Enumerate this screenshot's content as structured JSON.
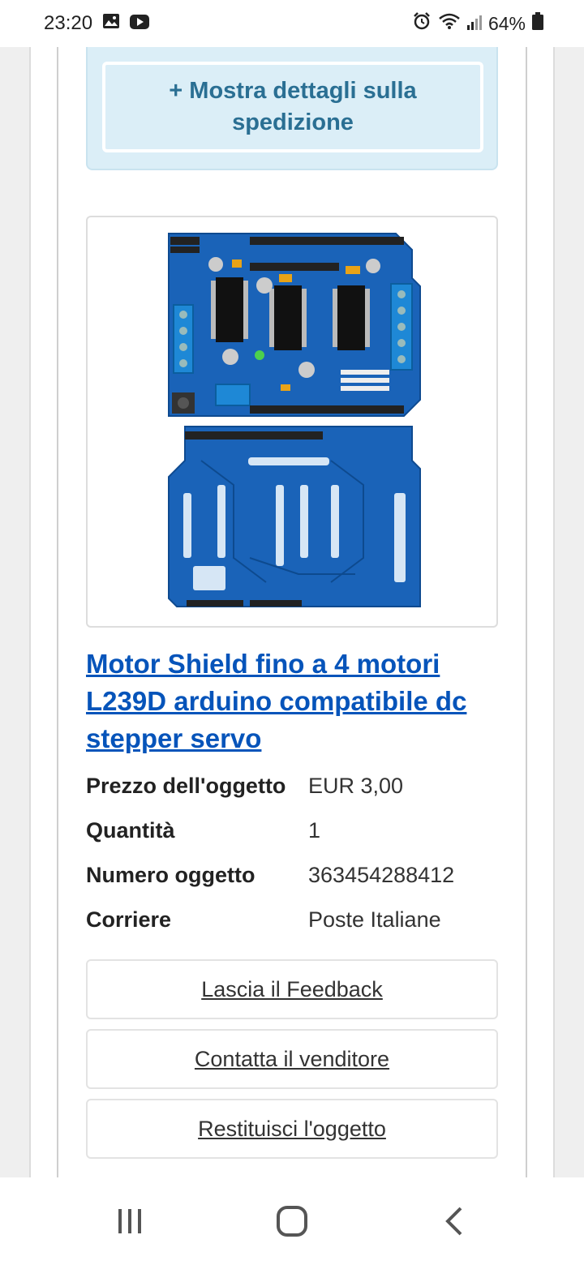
{
  "status_bar": {
    "time": "23:20",
    "battery": "64%",
    "left_icons": [
      "gallery-icon",
      "youtube-icon"
    ],
    "right_icons": [
      "alarm-icon",
      "wifi-icon",
      "signal-icon",
      "battery-icon"
    ]
  },
  "shipping": {
    "toggle_label": "+ Mostra dettagli sulla spedizione"
  },
  "product": {
    "title": "Motor Shield fino a 4 motori L239D arduino compatibile dc stepper servo",
    "image_alt": "Motor Shield L293D PCB top and bottom view",
    "details": [
      {
        "label": "Prezzo dell'oggetto",
        "value": "EUR 3,00"
      },
      {
        "label": "Quantità",
        "value": "1"
      },
      {
        "label": "Numero oggetto",
        "value": "363454288412"
      },
      {
        "label": "Corriere",
        "value": "Poste Italiane"
      }
    ]
  },
  "actions": {
    "feedback": "Lascia il Feedback",
    "contact": "Contatta il venditore",
    "return": "Restituisci l'oggetto"
  },
  "colors": {
    "link": "#0654ba",
    "ship_bg": "#dbeef7",
    "ship_text": "#2a6f93",
    "pcb": "#1a63b8"
  },
  "nav_bar": {
    "icons": [
      "recent-apps-icon",
      "home-icon",
      "back-icon"
    ]
  }
}
